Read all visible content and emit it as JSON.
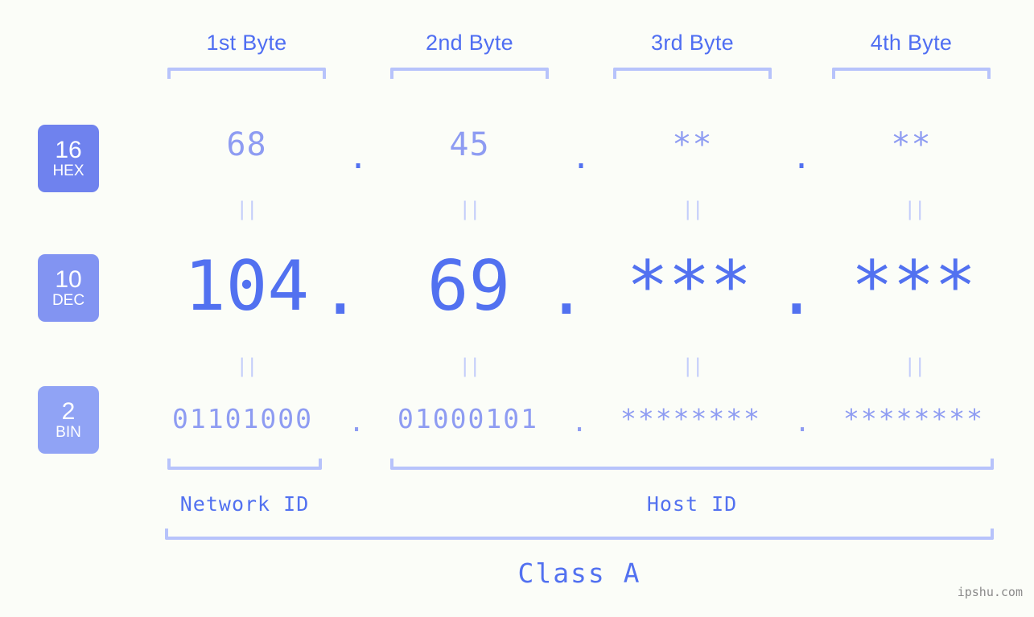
{
  "watermark": "ipshu.com",
  "byte_headers": [
    {
      "label": "1st Byte"
    },
    {
      "label": "2nd Byte"
    },
    {
      "label": "3rd Byte"
    },
    {
      "label": "4th Byte"
    }
  ],
  "bases": [
    {
      "number": "16",
      "name": "HEX",
      "color": "#6f82ee"
    },
    {
      "number": "10",
      "name": "DEC",
      "color": "#8294f2"
    },
    {
      "number": "2",
      "name": "BIN",
      "color": "#90a3f5"
    }
  ],
  "rows": {
    "hex": {
      "values": [
        "68",
        "45",
        "**",
        "**"
      ],
      "separator": "."
    },
    "dec": {
      "values": [
        "104",
        "69",
        "***",
        "***"
      ],
      "separator": "."
    },
    "bin": {
      "values": [
        "01101000",
        "01000101",
        "********",
        "********"
      ],
      "separator": "."
    }
  },
  "equality_symbol": "||",
  "segments": {
    "network_id": "Network ID",
    "host_id": "Host ID",
    "class": "Class A"
  },
  "colors": {
    "background": "#fbfdf8",
    "accent_strong": "#5271f0",
    "accent_light": "#8e9cf2",
    "bracket": "#b7c3fb",
    "equals": "#c3cdfb",
    "watermark": "#8a8a8a"
  }
}
